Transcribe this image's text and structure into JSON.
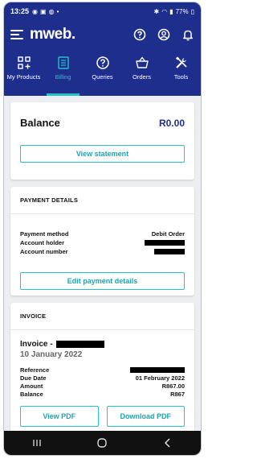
{
  "status_bar": {
    "time": "13:25",
    "battery": "77%"
  },
  "header": {
    "logo": "mweb."
  },
  "tabs": [
    {
      "label": "My Products",
      "icon": "grid-plus-icon"
    },
    {
      "label": "Billing",
      "icon": "document-icon",
      "active": true
    },
    {
      "label": "Queries",
      "icon": "question-icon"
    },
    {
      "label": "Orders",
      "icon": "basket-icon"
    },
    {
      "label": "Tools",
      "icon": "tools-icon"
    }
  ],
  "balance": {
    "label": "Balance",
    "value": "R0.00",
    "button": "View statement"
  },
  "payment": {
    "title": "PAYMENT DETAILS",
    "method_label": "Payment method",
    "method_value": "Debit Order",
    "holder_label": "Account holder",
    "number_label": "Account number",
    "button": "Edit payment details"
  },
  "invoice": {
    "title": "INVOICE",
    "name_prefix": "Invoice -",
    "date": "10 January 2022",
    "reference_label": "Reference",
    "due_label": "Due Date",
    "due_value": "01 February 2022",
    "amount_label": "Amount",
    "amount_value": "R867.00",
    "balance_label": "Balance",
    "balance_value": "R867",
    "view_pdf": "View PDF",
    "download_pdf": "Download PDF"
  },
  "colors": {
    "brand": "#1d2e8d",
    "accent": "#27c0c8"
  }
}
